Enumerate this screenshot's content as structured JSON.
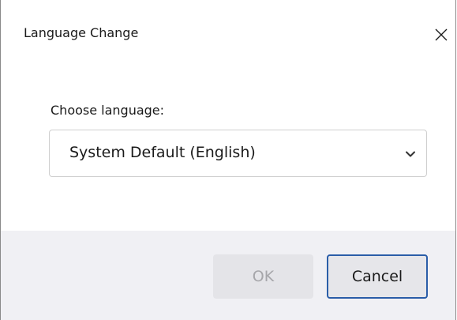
{
  "dialog": {
    "title": "Language Change",
    "close_icon": "close-icon"
  },
  "content": {
    "label": "Choose language:",
    "select": {
      "value": "System Default (English)",
      "chevron_icon": "chevron-down-icon"
    }
  },
  "footer": {
    "ok_label": "OK",
    "ok_enabled": false,
    "cancel_label": "Cancel"
  },
  "colors": {
    "footer_bg": "#f0f0f4",
    "focus_border": "#2a5da8",
    "disabled_text": "#a6a6aa"
  }
}
